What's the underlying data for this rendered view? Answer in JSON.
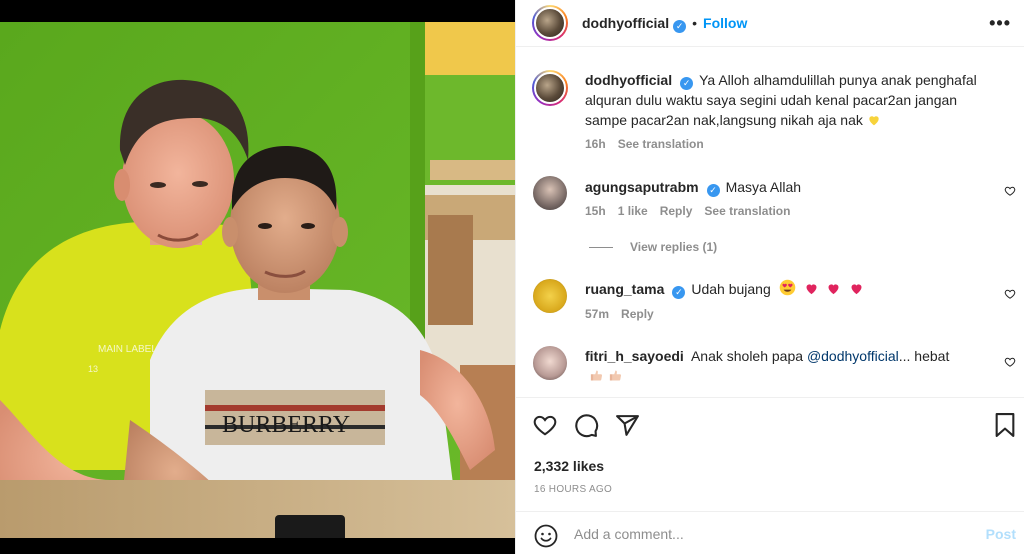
{
  "post": {
    "author": "dodhyofficial",
    "follow_label": "Follow",
    "more_label": "•••",
    "caption_user": "dodhyofficial",
    "caption": "Ya Alloh alhamdulillah punya anak penghafal alquran dulu waktu saya segini udah kenal pacar2an jangan sampe pacar2an nak,langsung nikah aja nak",
    "caption_emoji": "yellow-heart",
    "caption_time": "16h",
    "see_translation": "See translation"
  },
  "comments": [
    {
      "user": "agungsaputrabm",
      "verified": true,
      "text": "Masya Allah",
      "time": "15h",
      "likes": "1 like",
      "reply": "Reply",
      "see_translation": "See translation",
      "view_replies": "View replies (1)"
    },
    {
      "user": "ruang_tama",
      "verified": true,
      "text": "Udah bujang",
      "emojis": [
        "heart-eyes",
        "red-heart",
        "red-heart",
        "red-heart"
      ],
      "time": "57m",
      "reply": "Reply"
    },
    {
      "user": "fitri_h_sayoedi",
      "verified": false,
      "text": "Anak sholeh papa",
      "mention": "@dodhyofficial",
      "text_after": "... hebat",
      "emojis": [
        "thumbs-up",
        "thumbs-up"
      ]
    }
  ],
  "footer": {
    "likes": "2,332 likes",
    "time": "16 HOURS AGO",
    "add_comment_placeholder": "Add a comment...",
    "post_label": "Post"
  },
  "photo": {
    "shirt_text_1": "MAIN LABEL",
    "shirt_text_2": "13",
    "shirt_text_3": "BURBERRY"
  },
  "colors": {
    "accent": "#0095f6",
    "verified": "#3897f0",
    "muted": "#8e8e8e",
    "post_disabled": "#b2dffc",
    "wall_green": "#5fae1f",
    "shirt_yellow": "#d8e11c"
  }
}
